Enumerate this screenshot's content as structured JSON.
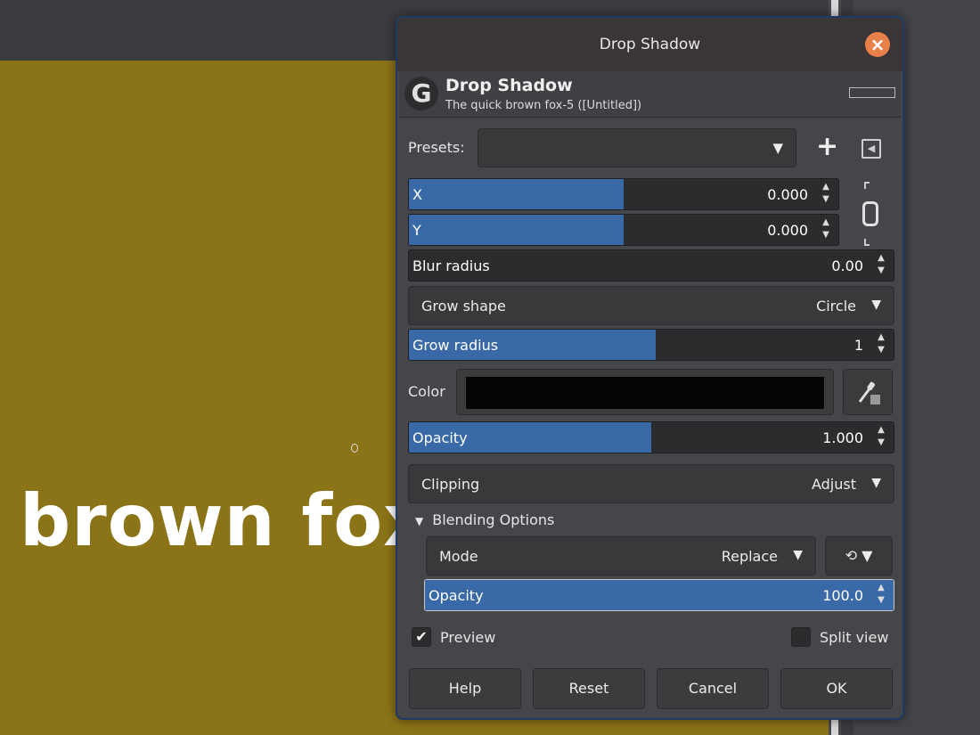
{
  "canvas": {
    "text": "brown fox"
  },
  "dialog": {
    "window_title": "Drop Shadow",
    "header_title": "Drop Shadow",
    "header_subtitle": "The quick brown fox-5 ([Untitled])",
    "presets_label": "Presets:",
    "presets_value": "",
    "x": {
      "label": "X",
      "value": "0.000",
      "fill_fraction": 0.5
    },
    "y": {
      "label": "Y",
      "value": "0.000",
      "fill_fraction": 0.5
    },
    "blur_radius": {
      "label": "Blur radius",
      "value": "0.00",
      "fill_fraction": 0.0
    },
    "grow_shape": {
      "label": "Grow shape",
      "value": "Circle"
    },
    "grow_radius": {
      "label": "Grow radius",
      "value": "1",
      "fill_fraction": 0.51
    },
    "color": {
      "label": "Color",
      "value": "#050507"
    },
    "opacity": {
      "label": "Opacity",
      "value": "1.000",
      "fill_fraction": 0.5
    },
    "clipping": {
      "label": "Clipping",
      "value": "Adjust"
    },
    "blending_options": {
      "label": "Blending Options",
      "expanded": true
    },
    "mode": {
      "label": "Mode",
      "value": "Replace"
    },
    "blend_opacity": {
      "label": "Opacity",
      "value": "100.0",
      "fill_fraction": 1.0
    },
    "preview": {
      "label": "Preview",
      "checked": true
    },
    "split_view": {
      "label": "Split view",
      "checked": false
    },
    "buttons": {
      "help": "Help",
      "reset": "Reset",
      "cancel": "Cancel",
      "ok": "OK"
    }
  },
  "colors": {
    "accent": "#3a69a8",
    "canvas": "#8b7317",
    "close": "#e8804a"
  },
  "icons": [
    "gimp-logo-icon",
    "close-icon",
    "chevron-down-icon",
    "plus-icon",
    "presets-menu-icon",
    "chain-link-icon",
    "color-picker-icon",
    "reset-icon",
    "checkmark-icon"
  ]
}
